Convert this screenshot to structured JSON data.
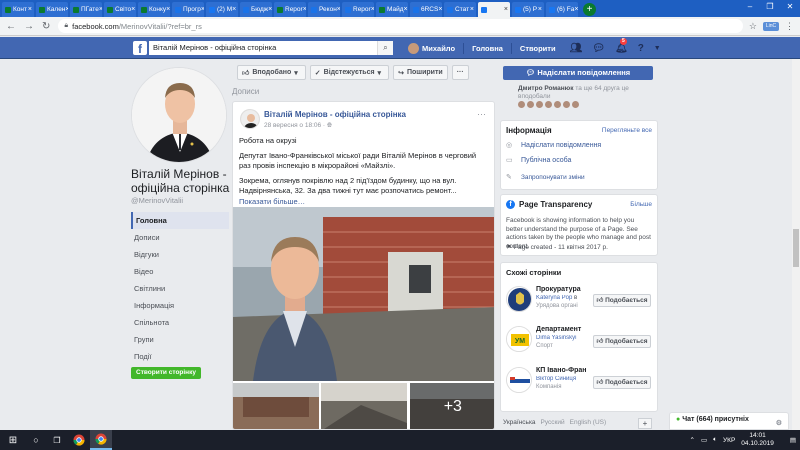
{
  "browser": {
    "tabs": [
      {
        "label": "Конт",
        "fav": "#0a7a2f"
      },
      {
        "label": "Кален",
        "fav": "#0a7a2f"
      },
      {
        "label": "ПГате",
        "fav": "#0a7a2f"
      },
      {
        "label": "Світо",
        "fav": "#0a7a2f"
      },
      {
        "label": "Конку",
        "fav": "#0a7a2f"
      },
      {
        "label": "Прогр",
        "fav": "#1a73e8"
      },
      {
        "label": "(2) М",
        "fav": "#1877f2"
      },
      {
        "label": "Бюдж",
        "fav": "#1a73e8"
      },
      {
        "label": "Repor",
        "fav": "#0a7a2f"
      },
      {
        "label": "Рекон",
        "fav": "#1a73e8"
      },
      {
        "label": "Repor",
        "fav": "#1a73e8"
      },
      {
        "label": "Майд",
        "fav": "#0a7a2f"
      },
      {
        "label": "6RCS",
        "fav": "#1a73e8"
      },
      {
        "label": "Стат",
        "fav": "#1a73e8"
      },
      {
        "label": "",
        "fav": "#1877f2",
        "active": true
      },
      {
        "label": "(5) Р",
        "fav": "#1877f2"
      },
      {
        "label": "(6) Fa",
        "fav": "#1877f2"
      }
    ],
    "url_host": "facebook.com",
    "url_path": "/MerinovVitalii/?ref=br_rs",
    "extension_label": "LinC"
  },
  "fb": {
    "logo": "f",
    "search_value": "Віталій Мерінов - офіційна сторінка",
    "user_name": "Михайло",
    "nav_home": "Головна",
    "nav_create": "Створити",
    "notif_count": "5"
  },
  "profile": {
    "name": "Віталій Мерінов - офіційна сторінка",
    "handle": "@MerinovVitalii",
    "nav": [
      "Головна",
      "Дописи",
      "Відгуки",
      "Відео",
      "Світлини",
      "Інформація",
      "Спільнота",
      "Групи",
      "Події"
    ],
    "create_page": "Створити сторінку"
  },
  "actions": {
    "liked": "Вподобано",
    "following": "Відстежується",
    "share": "Поширити",
    "more": "···"
  },
  "posts_label": "Дописи",
  "post": {
    "author": "Віталій Мерінов - офіційна сторінка",
    "meta": "28 вересня о 18:06 · ",
    "p1": "Робота на окрузі",
    "p2": "Депутат Івано-Франківської міської ради Віталій Мерінов в черговий раз провів інспекцію в мікрорайоні «Майзлі».",
    "p3": "Зокрема, оглянув покрівлю над 2 під'їздом будинку, що на вул. Надвірнянська, 32. За два тижні тут має розпочатись ремонт...",
    "more": "Показати більше…",
    "extra_photos": "+3"
  },
  "right": {
    "send_message": "Надіслати повідомлення",
    "likers_prefix": "Дмитро Романюк",
    "likers_suffix": "та ще 64 друга це вподобали",
    "info_title": "Інформація",
    "suggest_edits": "Перегляньте все",
    "info_send": "Надіслати повідомлення",
    "info_category": "Публічна особа",
    "info_suggest": "Запропонувати зміни",
    "pt_title": "Page Transparency",
    "pt_more": "Більше",
    "pt_text": "Facebook is showing information to help you better understand the purpose of a Page. See actions taken by the people who manage and post content.",
    "pt_created": "Page created - 11 квітня 2017 р.",
    "similar_title": "Схожі сторінки",
    "similar": [
      {
        "name": "Прокуратура",
        "liker": "Kateryna Pop",
        "liker_rest": " в",
        "cat": "Урядова органі"
      },
      {
        "name": "Департамент",
        "liker": "Dima Yasinskyi",
        "liker_rest": "",
        "cat": "Спорт"
      },
      {
        "name": "КП Івано-Фран",
        "liker": "Віктор Синиця",
        "liker_rest": "",
        "cat": "Компанія"
      }
    ],
    "like_label": "Подобається",
    "langs": [
      "Українська",
      "Русский",
      "English (US)"
    ]
  },
  "chat": {
    "label": "Чат (664) присутніх"
  },
  "taskbar": {
    "lang": "УКР",
    "time": "14:01",
    "date": "04.10.2019"
  }
}
